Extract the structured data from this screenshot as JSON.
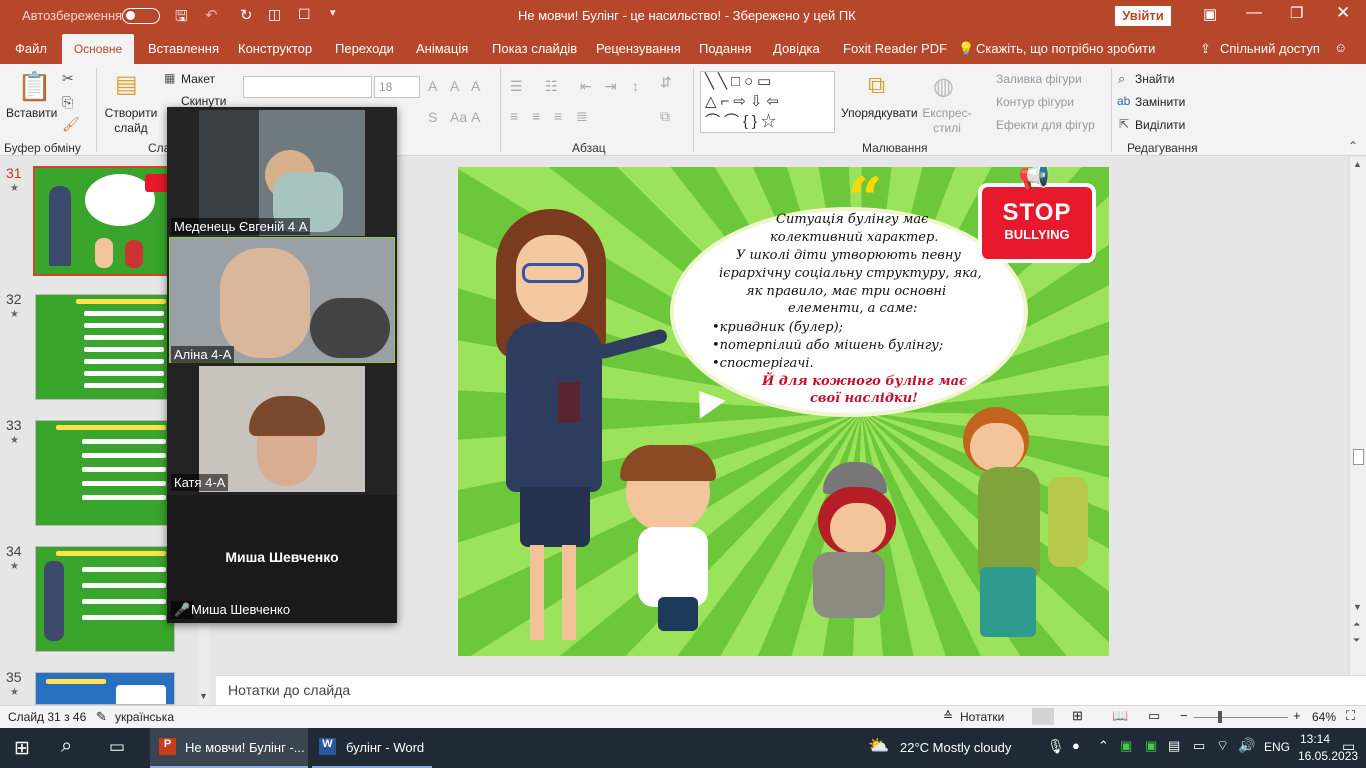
{
  "titlebar": {
    "autosave_label": "Автозбереження",
    "doc_title": "Не мовчи! Булінг - це насильство!  -  Збережено у цей ПК",
    "signin": "Увійти"
  },
  "tabs": [
    "Файл",
    "Основне",
    "Вставлення",
    "Конструктор",
    "Переходи",
    "Анімація",
    "Показ слайдів",
    "Рецензування",
    "Подання",
    "Довідка",
    "Foxit Reader PDF"
  ],
  "tellme": "Скажіть, що потрібно зробити",
  "share": "Спільний доступ",
  "ribbon": {
    "paste": "Вставити",
    "clipboard": "Буфер обміну",
    "new_slide": "Створити слайд",
    "layout": "Макет",
    "reset": "Скинути",
    "slides_grp": "Сла",
    "font_size": "18",
    "paragraph": "Абзац",
    "arrange": "Упорядкувати",
    "styles": "Експрес-стилі",
    "fill": "Заливка фігури",
    "outline": "Контур фігури",
    "effects": "Ефекти для фігур",
    "drawing": "Малювання",
    "find": "Знайти",
    "replace": "Замінити",
    "select": "Виділити",
    "editing": "Редагування"
  },
  "slides": [
    {
      "n": "31"
    },
    {
      "n": "32"
    },
    {
      "n": "33"
    },
    {
      "n": "34"
    },
    {
      "n": "35"
    }
  ],
  "slide": {
    "title": "Ситуація булінгу має колективний характер.",
    "lines": [
      "Ситуація булінгу має",
      "колективний характер.",
      "У школі діти утворюють певну",
      "ієрархічну соціальну структуру, яка,",
      "як правило,  має три основні",
      "елементи, а саме:",
      "•кривдник (булер);",
      "•потерпілий або мішень булінгу;",
      "•спостерігачі."
    ],
    "red1": "Й для кожного булінг має",
    "red2": "свої наслідки!",
    "stop1": "STOP",
    "stop2": "BULLYING"
  },
  "zoom": {
    "p1": "Меденець Євгеній 4 А",
    "p2": "Аліна 4-А",
    "p3": "Катя  4-А",
    "p4_big": "Миша Шевченко",
    "p4": "Миша Шевченко"
  },
  "notes": "Нотатки до слайда",
  "status": {
    "slide": "Слайд 31 з 46",
    "lang": "українська",
    "notes": "Нотатки",
    "zoom": "64%"
  },
  "taskbar": {
    "app1": "Не мовчи! Булінг -...",
    "app2": "булінг - Word",
    "weather": "22°C  Mostly cloudy",
    "lang": "ENG",
    "time": "13:14",
    "date": "16.05.2023"
  },
  "colors": {
    "accent": "#b7472a",
    "red_text": "#c8102e",
    "stop": "#e8192c"
  }
}
